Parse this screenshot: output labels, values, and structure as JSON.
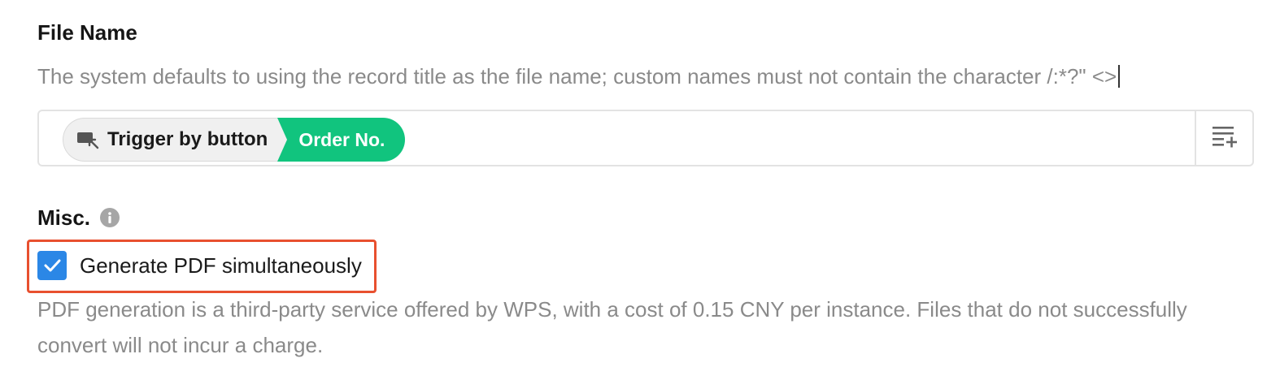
{
  "file_name": {
    "title": "File Name",
    "description": "The system defaults to using the record title as the file name; custom names must not contain the character /:*?\" <>",
    "tags": [
      {
        "label": "Trigger by button",
        "icon": "trigger-button-icon"
      },
      {
        "label": "Order No.",
        "color": "#11c47e"
      }
    ],
    "insert_field_icon": "insert-field-icon"
  },
  "misc": {
    "title": "Misc.",
    "info_icon": "info-icon",
    "generate_pdf": {
      "label": "Generate PDF simultaneously",
      "checked": true,
      "highlight_color": "#e8502f"
    },
    "pdf_description": "PDF generation is a third-party service offered by WPS, with a cost of 0.15 CNY per instance. Files that do not successfully convert will not incur a charge."
  },
  "colors": {
    "accent_green": "#11c47e",
    "checkbox_blue": "#2b87e6",
    "highlight_red": "#e8502f"
  }
}
